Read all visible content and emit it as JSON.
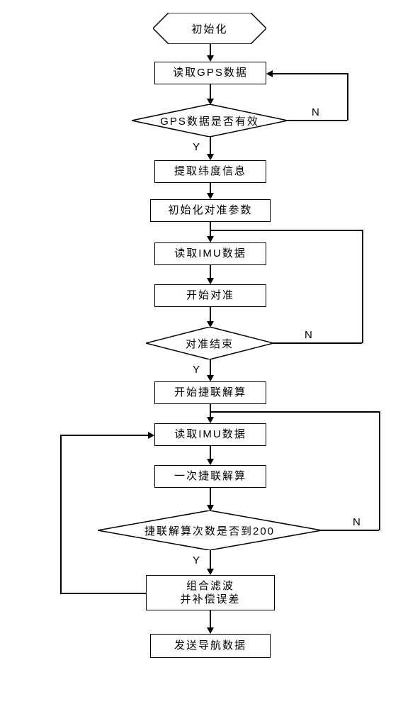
{
  "flowchart": {
    "type": "process-flowchart",
    "nodes": {
      "start": {
        "label": "初始化",
        "shape": "hexagon"
      },
      "read_gps": {
        "label": "读取GPS数据",
        "shape": "process"
      },
      "gps_valid": {
        "label": "GPS数据是否有效",
        "shape": "decision"
      },
      "extract_lat": {
        "label": "提取纬度信息",
        "shape": "process"
      },
      "init_align": {
        "label": "初始化对准参数",
        "shape": "process"
      },
      "read_imu1": {
        "label": "读取IMU数据",
        "shape": "process"
      },
      "start_align": {
        "label": "开始对准",
        "shape": "process"
      },
      "align_done": {
        "label": "对准结束",
        "shape": "decision"
      },
      "start_sins": {
        "label": "开始捷联解算",
        "shape": "process"
      },
      "read_imu2": {
        "label": "读取IMU数据",
        "shape": "process"
      },
      "one_sins": {
        "label": "一次捷联解算",
        "shape": "process"
      },
      "count_200": {
        "label": "捷联解算次数是否到200",
        "shape": "decision"
      },
      "filter": {
        "label": "组合滤波\n并补偿误差",
        "shape": "process"
      },
      "send": {
        "label": "发送导航数据",
        "shape": "process"
      }
    },
    "edges": {
      "yes": "Y",
      "no": "N"
    },
    "constants": {
      "sins_count_threshold": 200
    }
  }
}
